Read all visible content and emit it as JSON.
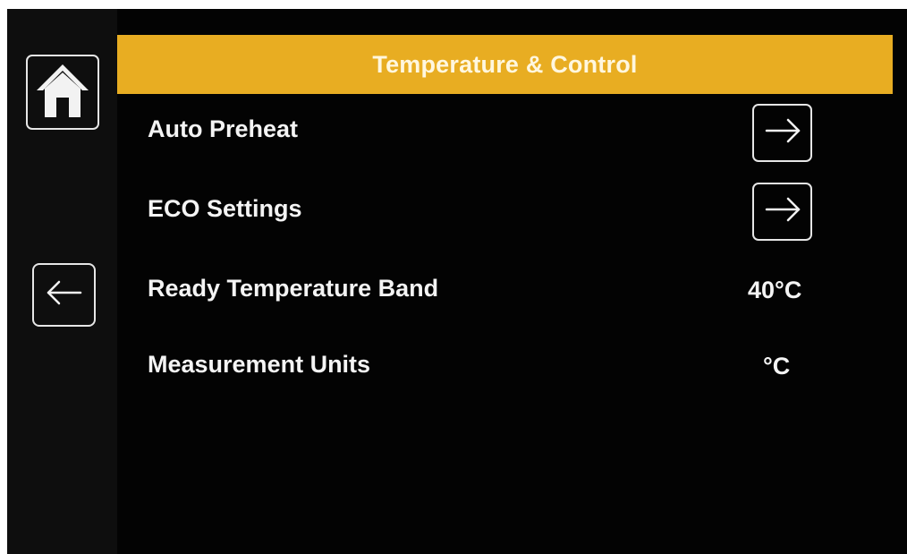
{
  "header": {
    "title": "Temperature & Control"
  },
  "sidebar": {
    "home_icon": "home-icon",
    "back_icon": "arrow-left-icon"
  },
  "settings": [
    {
      "label": "Auto Preheat",
      "control": "arrow-right-icon"
    },
    {
      "label": "ECO Settings",
      "control": "arrow-right-icon"
    },
    {
      "label": "Ready Temperature Band",
      "value": "40°C"
    },
    {
      "label": "Measurement Units",
      "value": "°C"
    }
  ],
  "colors": {
    "accent": "#e8ad22",
    "background": "#030303",
    "text": "#f4f4f4"
  }
}
